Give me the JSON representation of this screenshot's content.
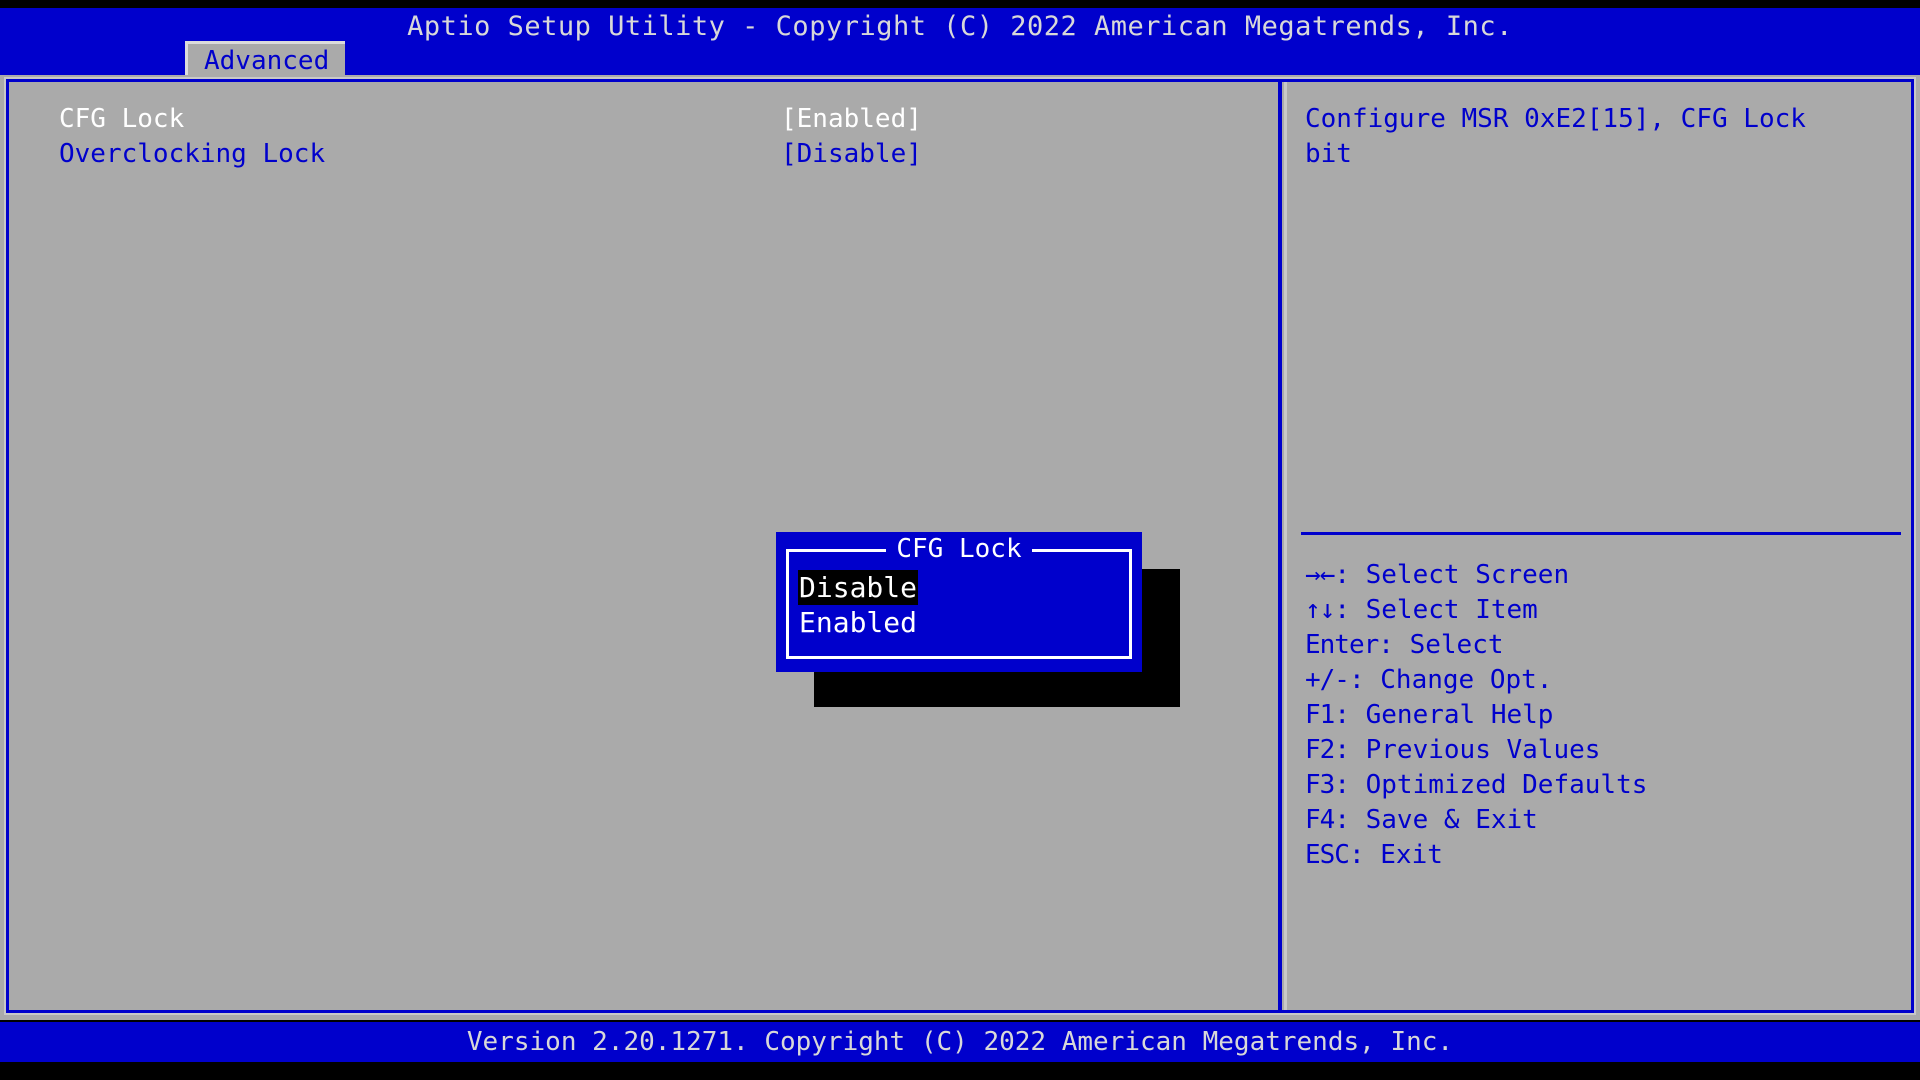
{
  "header": {
    "title": "Aptio Setup Utility - Copyright (C) 2022 American Megatrends, Inc."
  },
  "tabs": [
    {
      "label": "Advanced",
      "active": true
    }
  ],
  "settings": [
    {
      "label": "CFG Lock",
      "value": "[Enabled]",
      "selected": true
    },
    {
      "label": "Overclocking Lock",
      "value": "[Disable]",
      "selected": false
    }
  ],
  "help": {
    "text": "Configure MSR 0xE2[15], CFG Lock bit"
  },
  "keys": [
    {
      "glyph": "→←",
      "label": ": Select Screen"
    },
    {
      "glyph": "↑↓",
      "label": ": Select Item"
    },
    {
      "glyph": "Enter",
      "label": ": Select"
    },
    {
      "glyph": "+/-",
      "label": ": Change Opt."
    },
    {
      "glyph": "F1",
      "label": ": General Help"
    },
    {
      "glyph": "F2",
      "label": ": Previous Values"
    },
    {
      "glyph": "F3",
      "label": ": Optimized Defaults"
    },
    {
      "glyph": "F4",
      "label": ": Save & Exit"
    },
    {
      "glyph": "ESC",
      "label": ": Exit"
    }
  ],
  "dialog": {
    "title": "CFG Lock",
    "options": [
      {
        "label": "Disable",
        "selected": true
      },
      {
        "label": "Enabled",
        "selected": false
      }
    ]
  },
  "footer": {
    "text": "Version 2.20.1271. Copyright (C) 2022 American Megatrends, Inc."
  },
  "colors": {
    "bios_blue": "#0000cc",
    "panel_gray": "#aaaaaa",
    "text_white": "#ffffff",
    "highlight_black": "#000000"
  }
}
